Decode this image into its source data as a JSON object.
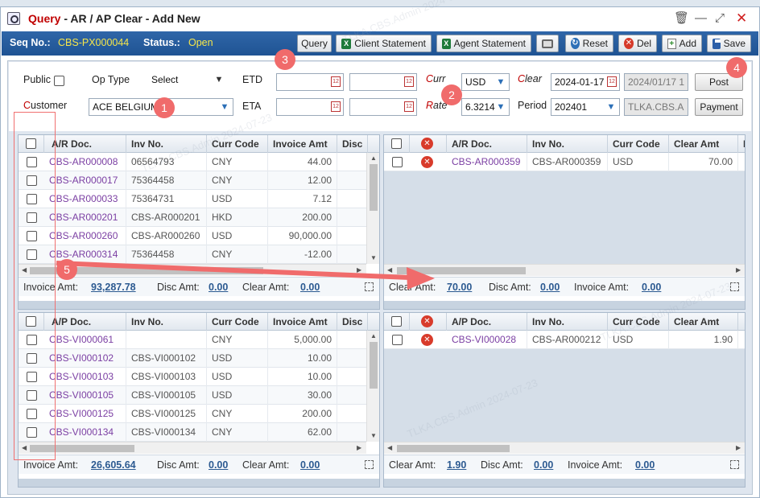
{
  "window": {
    "title_prefix": "Query",
    "title_rest": "- AR / AP Clear - Add New",
    "controls": [
      "🗑",
      "—",
      "⤢",
      "✕"
    ]
  },
  "header": {
    "seq_label": "Seq No.:",
    "seq_value": "CBS-PX000044",
    "status_label": "Status.:",
    "status_value": "Open",
    "buttons": {
      "query": "Query",
      "client_statement": "Client Statement",
      "agent_statement": "Agent Statement",
      "reset": "Reset",
      "del": "Del",
      "add": "Add",
      "save": "Save"
    }
  },
  "form": {
    "public_label": "Public",
    "op_type_label": "Op Type",
    "op_type_value": "Select",
    "etd_label": "ETD",
    "eta_label": "ETA",
    "customer_label_first": "C",
    "customer_label_rest": "ustomer",
    "customer_value": "ACE BELGIUM",
    "curr_label_first": "C",
    "curr_label_rest": "urr",
    "curr_value": "USD",
    "rate_label_first": "R",
    "rate_label_rest": "ate",
    "rate_value": "6.3214",
    "clear_label_first": "C",
    "clear_label_rest": "lear",
    "clear_date": "2024-01-17",
    "clear_date_readonly": "2024/01/17 1",
    "period_label": "Period",
    "period_value": "202401",
    "user_value": "TLKA.CBS.A",
    "post_button": "Post",
    "payment_button": "Payment"
  },
  "ar_left": {
    "headers": [
      "A/R Doc.",
      "Inv No.",
      "Curr Code",
      "Invoice Amt",
      "Disc"
    ],
    "rows": [
      [
        "CBS-AR000008",
        "06564793",
        "CNY",
        "44.00"
      ],
      [
        "CBS-AR000017",
        "75364458",
        "CNY",
        "12.00"
      ],
      [
        "CBS-AR000033",
        "75364731",
        "USD",
        "7.12"
      ],
      [
        "CBS-AR000201",
        "CBS-AR000201",
        "HKD",
        "200.00"
      ],
      [
        "CBS-AR000260",
        "CBS-AR000260",
        "USD",
        "90,000.00"
      ],
      [
        "CBS-AR000314",
        "75364458",
        "CNY",
        "-12.00"
      ]
    ],
    "footer": {
      "invoice_label": "Invoice Amt:",
      "invoice_value": "93,287.78",
      "disc_label": "Disc Amt:",
      "disc_value": "0.00",
      "clear_label": "Clear Amt:",
      "clear_value": "0.00"
    }
  },
  "ar_right": {
    "headers": [
      "A/R Doc.",
      "Inv No.",
      "Curr Code",
      "Clear Amt",
      "I"
    ],
    "rows": [
      [
        "CBS-AR000359",
        "CBS-AR000359",
        "USD",
        "70.00"
      ]
    ],
    "footer": {
      "clear_label": "Clear Amt:",
      "clear_value": "70.00",
      "disc_label": "Disc Amt:",
      "disc_value": "0.00",
      "invoice_label": "Invoice Amt:",
      "invoice_value": "0.00"
    }
  },
  "ap_left": {
    "headers": [
      "A/P Doc.",
      "Inv No.",
      "Curr Code",
      "Invoice Amt",
      "Disc"
    ],
    "rows": [
      [
        "CBS-VI000061",
        "",
        "CNY",
        "5,000.00"
      ],
      [
        "CBS-VI000102",
        "CBS-VI000102",
        "USD",
        "10.00"
      ],
      [
        "CBS-VI000103",
        "CBS-VI000103",
        "USD",
        "10.00"
      ],
      [
        "CBS-VI000105",
        "CBS-VI000105",
        "USD",
        "30.00"
      ],
      [
        "CBS-VI000125",
        "CBS-VI000125",
        "CNY",
        "200.00"
      ],
      [
        "CBS-VI000134",
        "CBS-VI000134",
        "CNY",
        "62.00"
      ]
    ],
    "footer": {
      "invoice_label": "Invoice Amt:",
      "invoice_value": "26,605.64",
      "disc_label": "Disc Amt:",
      "disc_value": "0.00",
      "clear_label": "Clear Amt:",
      "clear_value": "0.00"
    }
  },
  "ap_right": {
    "headers": [
      "A/P Doc.",
      "Inv No.",
      "Curr Code",
      "Clear Amt"
    ],
    "rows": [
      [
        "CBS-VI000028",
        "CBS-AR000212",
        "USD",
        "1.90"
      ]
    ],
    "footer": {
      "clear_label": "Clear Amt:",
      "clear_value": "1.90",
      "disc_label": "Disc Amt:",
      "disc_value": "0.00",
      "invoice_label": "Invoice Amt:",
      "invoice_value": "0.00"
    }
  },
  "annotations": [
    "1",
    "2",
    "3",
    "4",
    "5"
  ],
  "watermark": "TLKA.CBS.Admin 2024-07-23",
  "colors": {
    "accent": "#1f5393",
    "status": "#f6e64a",
    "link": "#7b3fa3",
    "badge": "#f06b6b"
  }
}
